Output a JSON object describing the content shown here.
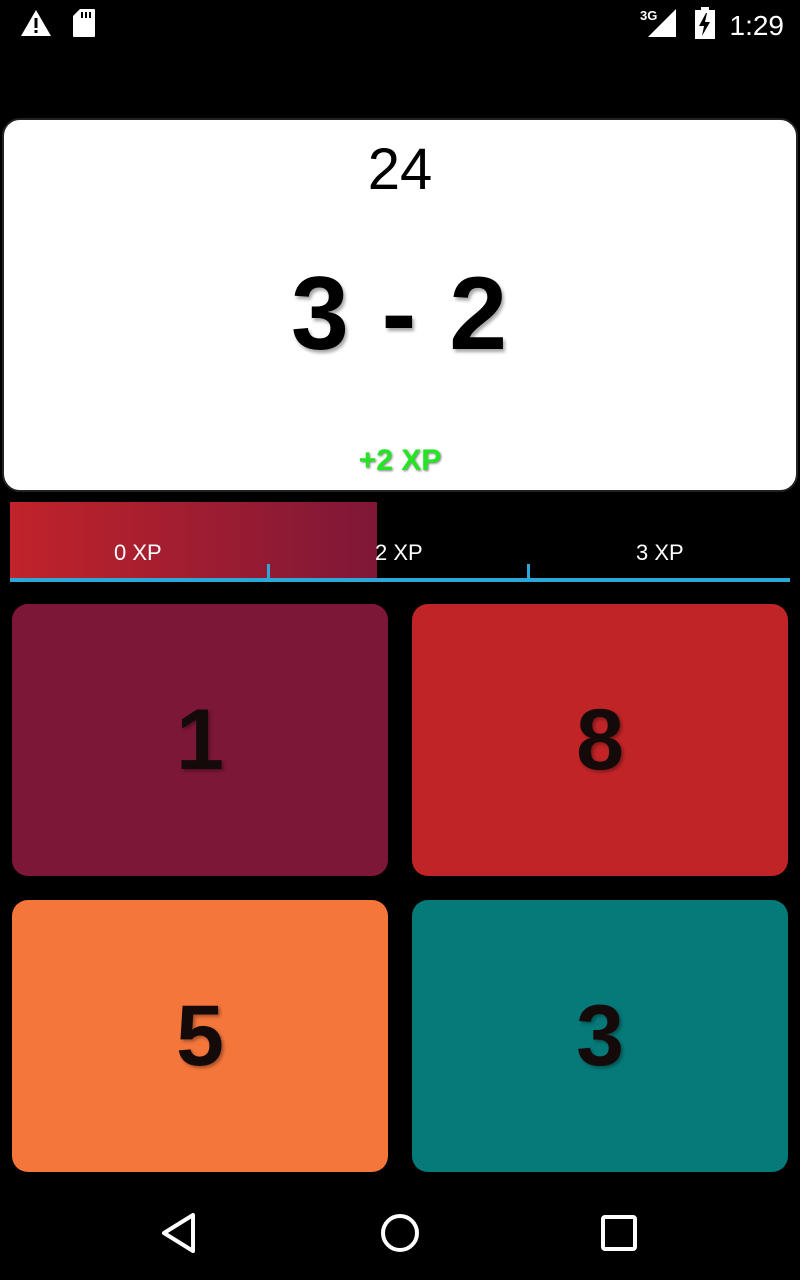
{
  "status_bar": {
    "time": "1:29",
    "network": "3G",
    "icons": [
      "warning-icon",
      "sd-card-icon",
      "signal-icon",
      "battery-charging-icon"
    ]
  },
  "game": {
    "timer": "24",
    "question": "3 - 2",
    "xp_gain": "+2 XP"
  },
  "xp_bar": {
    "labels": [
      "0 XP",
      "2 XP",
      "3 XP"
    ],
    "progress_percent": 47,
    "fill_colors": [
      "#c1232a",
      "#7e1737"
    ],
    "track_color": "#2aa8d8"
  },
  "answers": [
    {
      "value": "1",
      "color": "#7d1737"
    },
    {
      "value": "8",
      "color": "#c02427"
    },
    {
      "value": "5",
      "color": "#f4763b"
    },
    {
      "value": "3",
      "color": "#067a79"
    }
  ],
  "nav_bar": {
    "icons": [
      "back-icon",
      "home-icon",
      "recent-apps-icon"
    ]
  }
}
